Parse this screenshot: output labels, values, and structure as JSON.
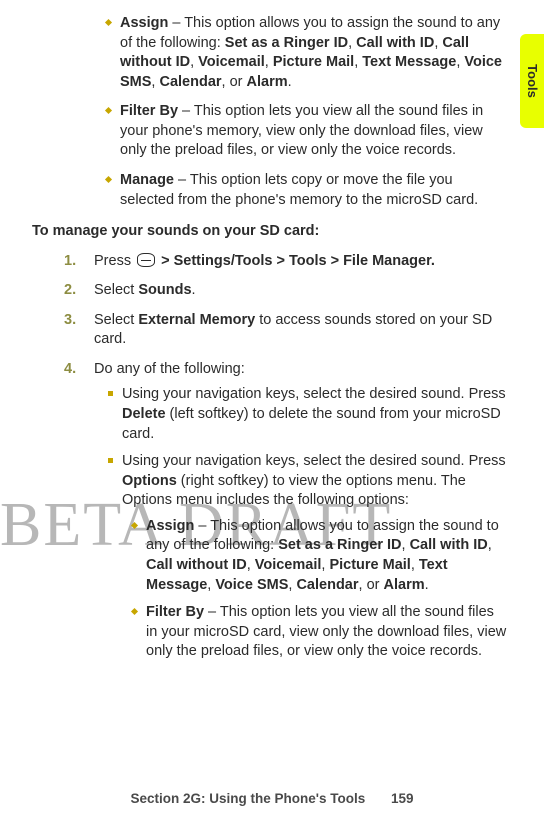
{
  "sideTab": {
    "label": "Tools"
  },
  "watermark": "BETA DRAFT",
  "topBullets": {
    "assign": {
      "head": "Assign",
      "lead": " – This option allows you to assign the sound to any of the following: ",
      "opt1": "Set as a Ringer ID",
      "opt2": "Call with ID",
      "opt3": "Call without ID",
      "opt4": "Voicemail",
      "opt5": "Picture Mail",
      "opt6": "Text Message",
      "opt7": "Voice SMS",
      "opt8": "Calendar",
      "opt9": "Alarm"
    },
    "filterBy": {
      "head": "Filter By",
      "text": " – This option lets you view all the sound files in your phone's memory, view only the download files, view only the preload files, or view only the voice records."
    },
    "manage": {
      "head": "Manage",
      "text": " – This option lets copy or move the file you selected from the phone's memory to the microSD card."
    }
  },
  "sectionIntro": "To manage your sounds on your SD card:",
  "steps": {
    "s1": {
      "num": "1.",
      "lead": "Press ",
      "menuPath": " > Settings/Tools > Tools > File Manager."
    },
    "s2": {
      "num": "2.",
      "lead": "Select ",
      "bold": "Sounds",
      "tail": "."
    },
    "s3": {
      "num": "3.",
      "lead": "Select ",
      "bold": "External Memory",
      "tail": " to access sounds stored on your SD card."
    },
    "s4": {
      "num": "4.",
      "text": "Do any of the following:",
      "subA": {
        "pre": "Using your navigation keys, select the desired sound. Press ",
        "bold": "Delete",
        "post": " (left softkey) to delete the sound from your microSD card."
      },
      "subB": {
        "pre": "Using your navigation keys, select the desired sound. Press ",
        "bold": "Options",
        "post": " (right softkey) to view the options menu. The Options menu includes the following options:"
      },
      "inner": {
        "assign": {
          "head": "Assign",
          "lead": " – This option allows you to assign the sound to any of the following: ",
          "opt1": "Set as a Ringer ID",
          "opt2": "Call with ID",
          "opt3": "Call without ID",
          "opt4": "Voicemail",
          "opt5": "Picture Mail",
          "opt6": "Text Message",
          "opt7": "Voice SMS",
          "opt8": "Calendar",
          "opt9": "Alarm"
        },
        "filterBy": {
          "head": "Filter By",
          "text": " – This option lets you view all the sound files in your microSD card, view only the download files, view only the preload files, or view only the voice records."
        }
      }
    }
  },
  "footer": {
    "section": "Section 2G: Using the Phone's Tools",
    "page": "159"
  }
}
